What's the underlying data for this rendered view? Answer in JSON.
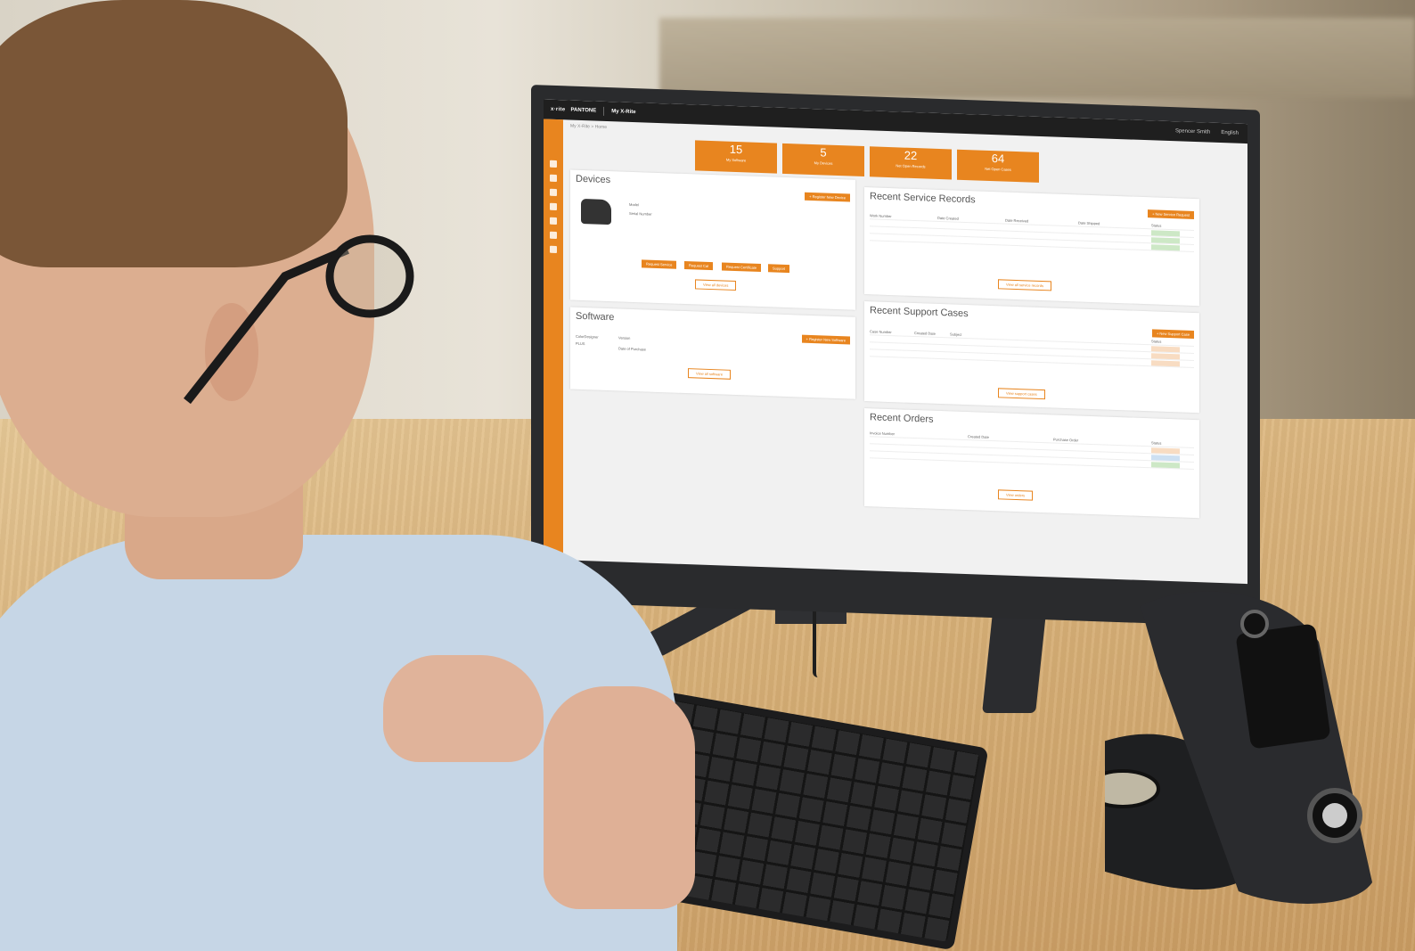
{
  "screen": {
    "topbar": {
      "brand": "x·rite",
      "brand2": "PANTONE",
      "title": "My X-Rite",
      "user": "Spencer Smith",
      "language": "English"
    },
    "breadcrumb": "My X-Rite > Home",
    "stats": [
      {
        "value": "15",
        "label": "My Software"
      },
      {
        "value": "5",
        "label": "My Devices"
      },
      {
        "value": "22",
        "label": "Net Open Records"
      },
      {
        "value": "64",
        "label": "Net Open Cases"
      }
    ],
    "devices": {
      "title": "Devices",
      "register_button": "+ Register New Device",
      "fields": [
        "Model",
        "Serial Number"
      ],
      "actions": [
        "Request Service",
        "Request Cal",
        "Request Certificate",
        "Support"
      ],
      "view_all": "View all devices"
    },
    "software": {
      "title": "Software",
      "product": "ColorDesigner",
      "version": "PLUS",
      "register_button": "+ Register New Software",
      "fields": [
        "Version",
        "Date of Purchase"
      ],
      "view_all": "View all software"
    },
    "service_records": {
      "title": "Recent Service Records",
      "new_button": "+ New Service Request",
      "columns": [
        "Work Number",
        "Date Created",
        "Date Received",
        "Date Shipped",
        "Status"
      ],
      "view_all": "View all service records"
    },
    "support_cases": {
      "title": "Recent Support Cases",
      "new_button": "+ New Support Case",
      "columns": [
        "Case Number",
        "Created Date",
        "Subject",
        "Status"
      ],
      "view_all": "View support cases"
    },
    "orders": {
      "title": "Recent Orders",
      "columns": [
        "Invoice Number",
        "Created Date",
        "Purchase Order",
        "Status"
      ],
      "view_all": "View orders"
    }
  },
  "colors": {
    "accent": "#e8851f",
    "topbar": "#1f1f1f",
    "screen_bg": "#f1f1f1"
  }
}
